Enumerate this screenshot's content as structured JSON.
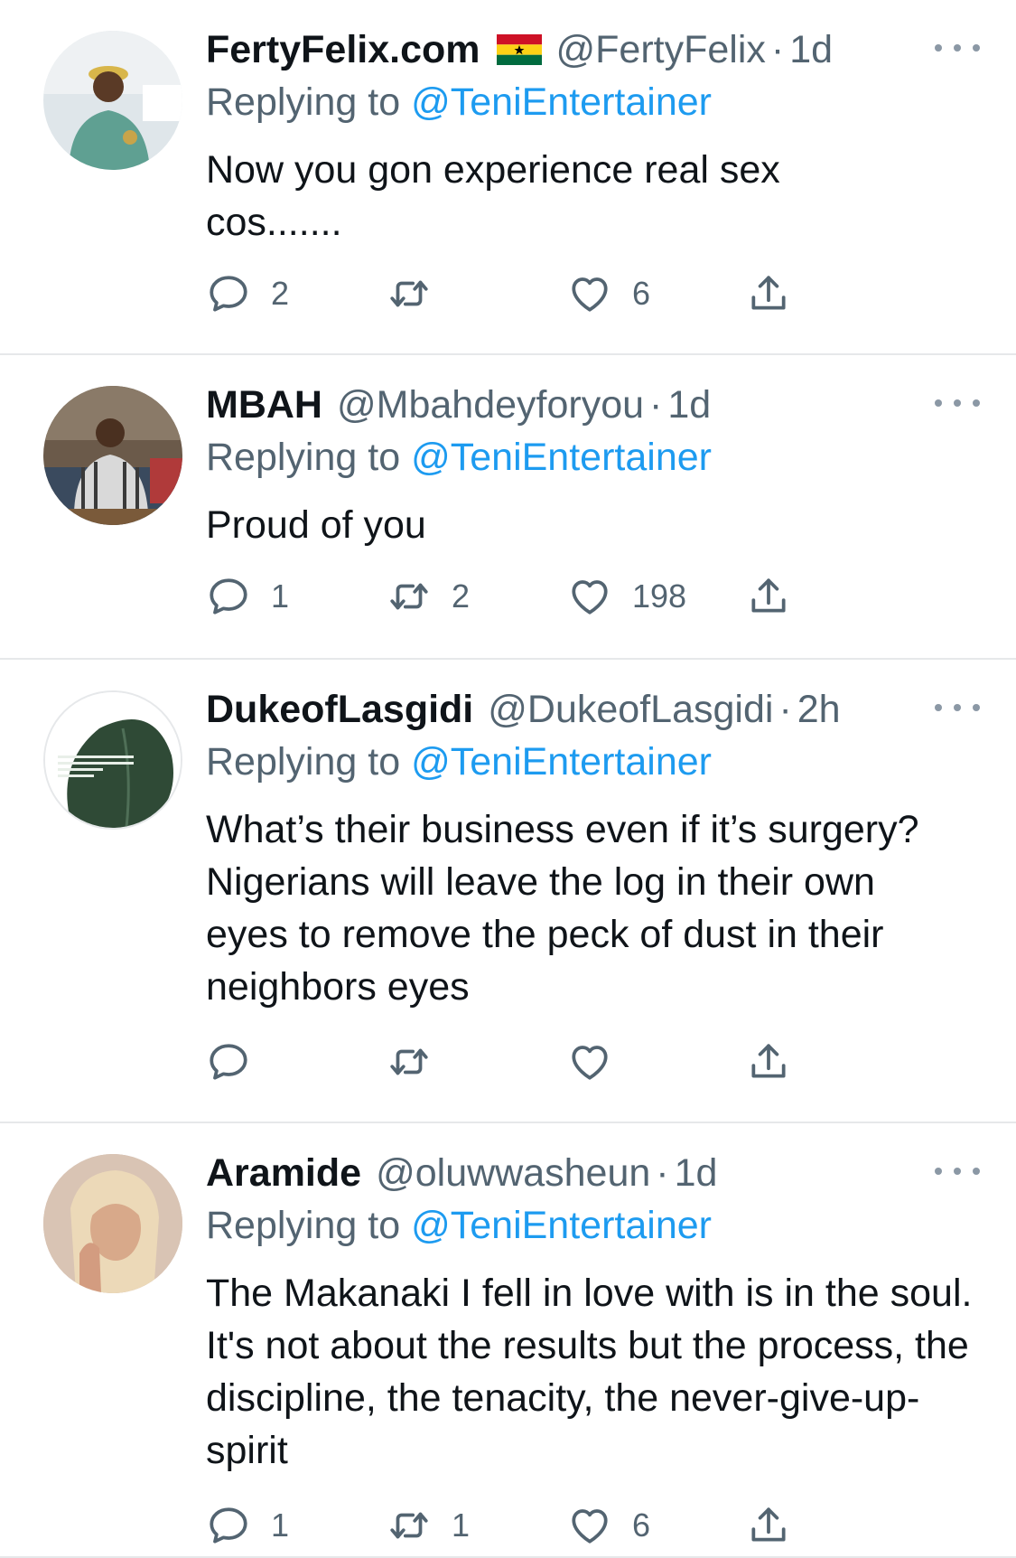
{
  "tweets": [
    {
      "display_name": "FertyFelix.com",
      "has_flag": true,
      "handle": "@FertyFelix",
      "time": "1d",
      "replying_prefix": "Replying to",
      "replying_to": "@TeniEntertainer",
      "text": "Now you gon experience real sex cos.......",
      "replies": "2",
      "retweets": "",
      "likes": "6"
    },
    {
      "display_name": "MBAH",
      "has_flag": false,
      "handle": "@Mbahdeyforyou",
      "time": "1d",
      "replying_prefix": "Replying to",
      "replying_to": "@TeniEntertainer",
      "text": "Proud of you",
      "replies": "1",
      "retweets": "2",
      "likes": "198"
    },
    {
      "display_name": "DukeofLasgidi",
      "has_flag": false,
      "handle": "@DukeofLasgidi",
      "time": "2h",
      "replying_prefix": "Replying to",
      "replying_to": "@TeniEntertainer",
      "text": "What’s their business even if it’s surgery? Nigerians will leave the log in their own eyes to remove the peck of dust in their neighbors eyes",
      "replies": "",
      "retweets": "",
      "likes": ""
    },
    {
      "display_name": "Aramide",
      "has_flag": false,
      "handle": "@oluwwasheun",
      "time": "1d",
      "replying_prefix": "Replying to",
      "replying_to": "@TeniEntertainer",
      "text": "The Makanaki I fell in love with is in the soul. It's not about the results but the process, the discipline, the tenacity, the never-give-up-spirit",
      "replies": "1",
      "retweets": "1",
      "likes": "6"
    }
  ],
  "icons": {
    "reply": "reply-icon",
    "retweet": "retweet-icon",
    "like": "heart-icon",
    "share": "share-icon",
    "more": "more-icon",
    "flag": "ghana-flag-icon"
  },
  "colors": {
    "text": "#0f1419",
    "secondary": "#536471",
    "link": "#1d9bf0",
    "divider": "#e6e8ea",
    "icon": "#536471"
  }
}
